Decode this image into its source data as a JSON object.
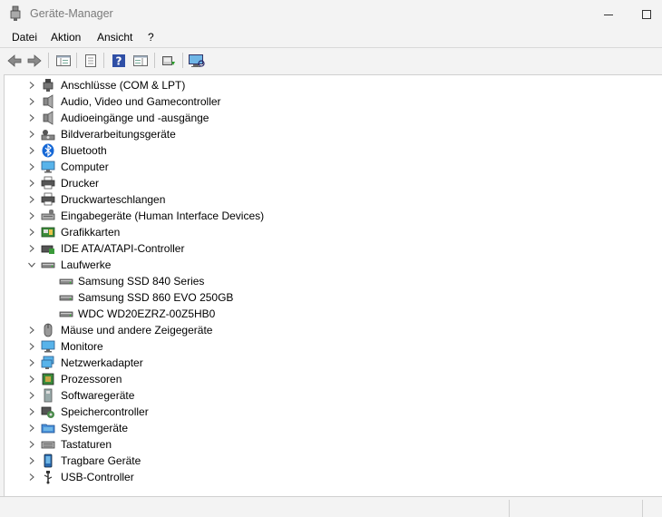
{
  "window": {
    "title": "Geräte-Manager",
    "accent": "#0078d4"
  },
  "menu": [
    "Datei",
    "Aktion",
    "Ansicht",
    "?"
  ],
  "toolbar": {
    "buttons": [
      "back-icon",
      "forward-icon",
      "show-hide-tree-icon",
      "properties-icon",
      "help-icon",
      "action-pane-icon",
      "update-driver-icon",
      "scan-hardware-icon"
    ]
  },
  "tree": {
    "items": [
      {
        "label": "Anschlüsse (COM & LPT)",
        "icon": "port-icon",
        "expanded": false
      },
      {
        "label": "Audio, Video und Gamecontroller",
        "icon": "speaker-icon",
        "expanded": false
      },
      {
        "label": "Audioeingänge und -ausgänge",
        "icon": "speaker-icon",
        "expanded": false
      },
      {
        "label": "Bildverarbeitungsgeräte",
        "icon": "camera-icon",
        "expanded": false
      },
      {
        "label": "Bluetooth",
        "icon": "bluetooth-icon",
        "expanded": false
      },
      {
        "label": "Computer",
        "icon": "monitor-icon",
        "expanded": false
      },
      {
        "label": "Drucker",
        "icon": "printer-icon",
        "expanded": false
      },
      {
        "label": "Druckwarteschlangen",
        "icon": "printer-icon",
        "expanded": false
      },
      {
        "label": "Eingabegeräte (Human Interface Devices)",
        "icon": "hid-icon",
        "expanded": false
      },
      {
        "label": "Grafikkarten",
        "icon": "display-adapter-icon",
        "expanded": false
      },
      {
        "label": "IDE ATA/ATAPI-Controller",
        "icon": "ide-controller-icon",
        "expanded": false
      },
      {
        "label": "Laufwerke",
        "icon": "disk-drive-icon",
        "expanded": true,
        "children": [
          "Samsung SSD 840 Series",
          "Samsung SSD 860 EVO 250GB",
          "WDC WD20EZRZ-00Z5HB0"
        ]
      },
      {
        "label": "Mäuse und andere Zeigegeräte",
        "icon": "mouse-icon",
        "expanded": false
      },
      {
        "label": "Monitore",
        "icon": "monitor-icon",
        "expanded": false
      },
      {
        "label": "Netzwerkadapter",
        "icon": "network-icon",
        "expanded": false
      },
      {
        "label": "Prozessoren",
        "icon": "cpu-icon",
        "expanded": false
      },
      {
        "label": "Softwaregeräte",
        "icon": "software-device-icon",
        "expanded": false
      },
      {
        "label": "Speichercontroller",
        "icon": "storage-controller-icon",
        "expanded": false
      },
      {
        "label": "Systemgeräte",
        "icon": "system-folder-icon",
        "expanded": false
      },
      {
        "label": "Tastaturen",
        "icon": "keyboard-icon",
        "expanded": false
      },
      {
        "label": "Tragbare Geräte",
        "icon": "portable-device-icon",
        "expanded": false
      },
      {
        "label": "USB-Controller",
        "icon": "usb-icon",
        "expanded": false
      }
    ]
  }
}
